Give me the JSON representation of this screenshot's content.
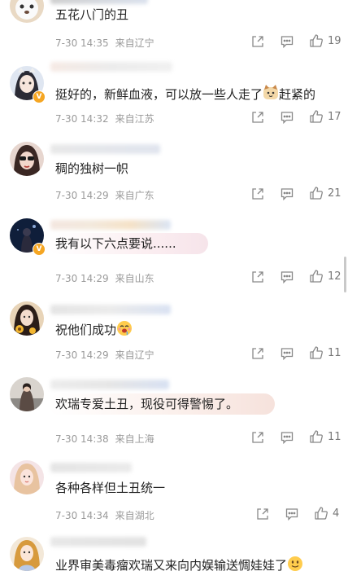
{
  "icons": {
    "share": "share-icon",
    "comment": "comment-icon",
    "like": "thumbs-up-icon"
  },
  "comments": [
    {
      "text": "五花八门的丑",
      "time": "7-30 14:35",
      "location": "来自辽宁",
      "likes": "19"
    },
    {
      "text": "挺好的，新鲜血液，可以放一些人走了",
      "text_after_emoji": "赶紧的",
      "emoji": "cat-face-emoji",
      "time": "7-30 14:32",
      "location": "来自江苏",
      "likes": "17"
    },
    {
      "text": "稠的独树一帜",
      "time": "7-30 14:29",
      "location": "来自广东",
      "likes": "21"
    },
    {
      "text": "我有以下六点要说......",
      "time": "7-30 14:29",
      "location": "来自山东",
      "likes": "12"
    },
    {
      "text": "祝他们成功",
      "emoji": "drooling-face-emoji",
      "time": "7-30 14:29",
      "location": "来自辽宁",
      "likes": "11"
    },
    {
      "text": "欢瑞专爱土丑，现役可得警惕了。",
      "time": "7-30 14:38",
      "location": "来自上海",
      "likes": "11"
    },
    {
      "text": "各种各样但土丑统一",
      "time": "7-30 14:34",
      "location": "来自湖北",
      "likes": "4"
    },
    {
      "text": "业界审美毒瘤欢瑞又来向内娱输送惆娃娃了",
      "emoji": "smiling-face-emoji"
    }
  ]
}
